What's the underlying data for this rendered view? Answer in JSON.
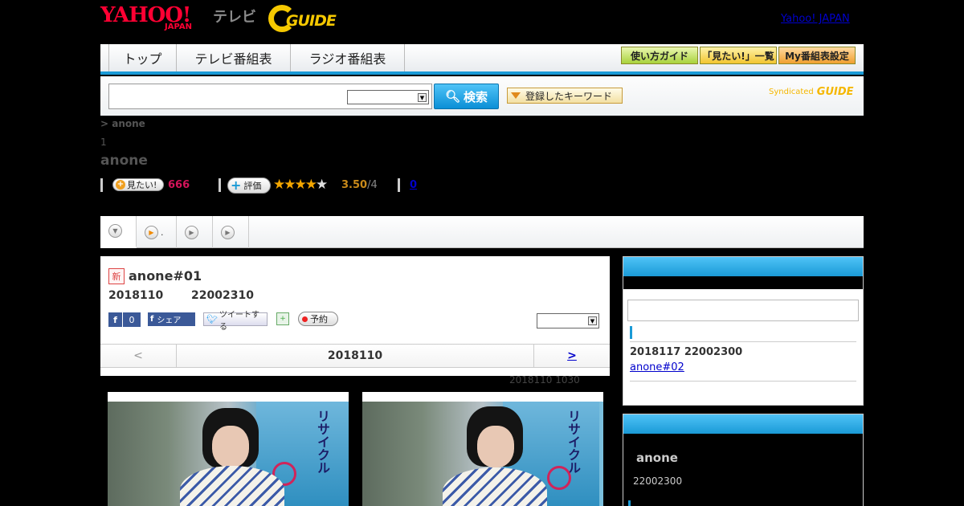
{
  "header": {
    "logo_yahoo": "YAHOO!",
    "logo_yahoo_sub": "JAPAN",
    "logo_tv": "テレビ",
    "logo_gguide": "GUIDE",
    "yahoo_japan_link": "Yahoo! JAPAN"
  },
  "nav": {
    "tabs": [
      "トップ",
      "テレビ番組表",
      "ラジオ番組表"
    ],
    "right_buttons": [
      "使い方ガイド",
      "「見たい!」一覧",
      "My番組表設定"
    ]
  },
  "search": {
    "button": "検索",
    "keyword_button": "登録したキーワード",
    "syndicated": "Syndicated",
    "syndicated_logo": "GUIDE"
  },
  "breadcrumb": "> anone",
  "crumb_num": "1",
  "program": {
    "title": "anone",
    "want_label": "見たい!",
    "want_count": "666",
    "rate_label": "評価",
    "stars_filled": "★★★★",
    "stars_empty": "★",
    "score": "3.50",
    "score_den": "/4",
    "zero_link": "0"
  },
  "tabs": [
    {
      "label": ""
    },
    {
      "label": "."
    },
    {
      "label": ""
    },
    {
      "label": ""
    }
  ],
  "episode": {
    "new_badge": "新",
    "title": "anone#01",
    "date": "2018110",
    "time": "22002310",
    "fb_like": "f",
    "fb_count": "0",
    "fb_share": "シェア",
    "tweet": "ツイートする",
    "reserve": "予約",
    "pager_prev": "<",
    "pager_mid": "2018110",
    "pager_next": ">",
    "update_note": "2018110  1030"
  },
  "photo_text": [
    "リサイクル",
    "リサイクル"
  ],
  "sidebar": {
    "next_date": "2018117  22002300",
    "next_link": "anone#02",
    "prog_title": "anone",
    "prog_time": "22002300"
  },
  "colors": {
    "accent_blue": "#1a9ad6",
    "want_count": "#d4145a",
    "score": "#c98a1a",
    "link": "#0000cc"
  }
}
